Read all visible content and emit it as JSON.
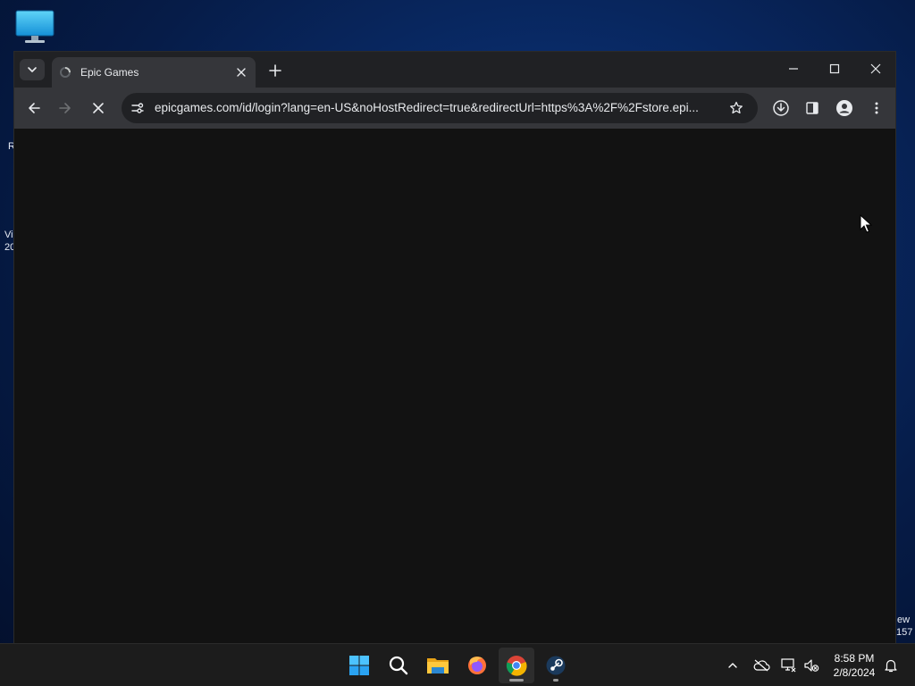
{
  "desktop": {
    "icon": "this-pc-icon",
    "edge_text": {
      "left_1": "R",
      "left_2": "Vi",
      "left_3": "20",
      "right_1": "ew",
      "right_2": "157"
    }
  },
  "browser": {
    "tab": {
      "title": "Epic Games",
      "favicon": "loading-favicon"
    },
    "address_bar": {
      "url": "epicgames.com/id/login?lang=en-US&noHostRedirect=true&redirectUrl=https%3A%2F%2Fstore.epi..."
    },
    "toolbar_icons": [
      "back-arrow-icon",
      "forward-arrow-icon",
      "stop-loading-icon",
      "site-info-icon",
      "bookmark-star-icon",
      "download-icon",
      "side-panel-icon",
      "profile-icon",
      "more-menu-icon"
    ],
    "window_controls": [
      "minimize-icon",
      "maximize-icon",
      "close-icon"
    ]
  },
  "taskbar": {
    "apps": [
      "windows-start-icon",
      "search-icon",
      "file-explorer-icon",
      "firefox-icon",
      "chrome-icon",
      "steam-icon"
    ],
    "active_app": "chrome",
    "tray": [
      "show-hidden-icons-chevron",
      "onedrive-offline-icon",
      "network-icon",
      "volume-muted-icon",
      "notification-bell-icon"
    ],
    "clock": {
      "time": "8:58 PM",
      "date": "2/8/2024"
    }
  },
  "colors": {
    "titlebar": "#202124",
    "toolbar": "#35363a",
    "omnibox": "#202124",
    "page": "#121212",
    "taskbar": "#1c1c1c"
  }
}
